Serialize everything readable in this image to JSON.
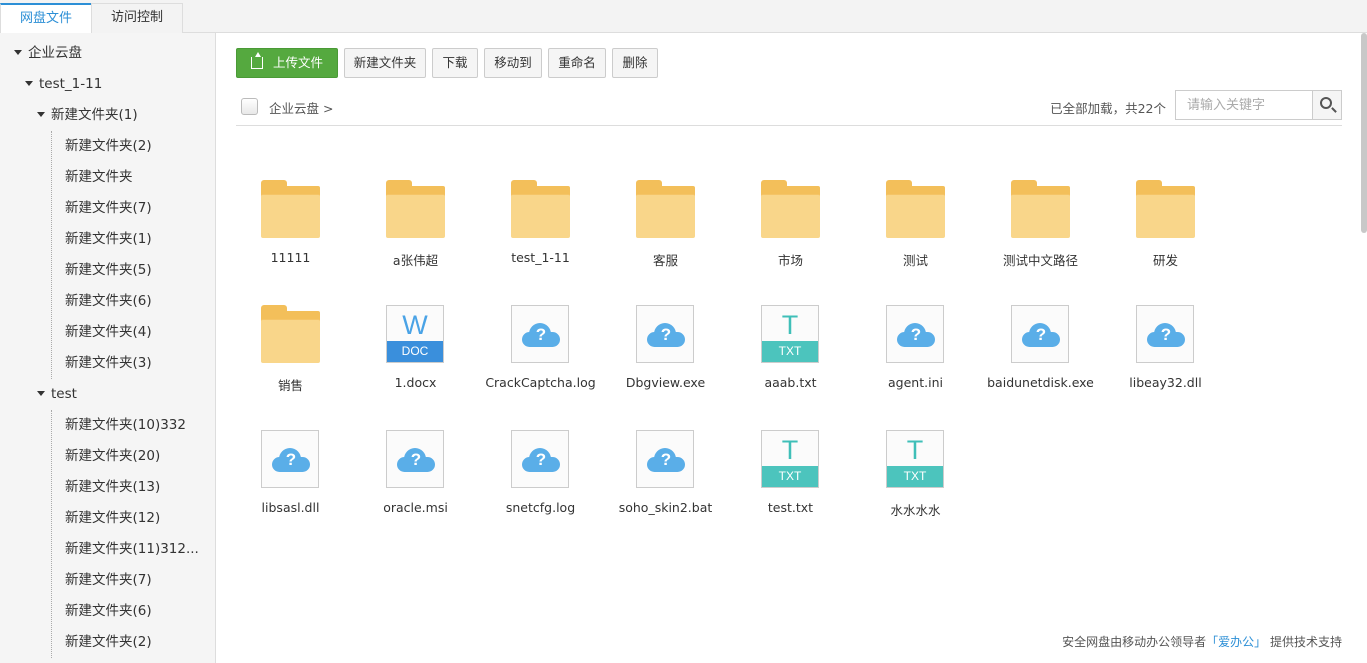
{
  "tabs": [
    {
      "label": "网盘文件",
      "active": true
    },
    {
      "label": "访问控制",
      "active": false
    }
  ],
  "sidebar": {
    "root": "企业云盘",
    "items": [
      {
        "label": "test_1-11",
        "level": 1,
        "expanded": true
      },
      {
        "label": "新建文件夹(1)",
        "level": 2,
        "expanded": true
      },
      {
        "label": "新建文件夹(2)",
        "level": 3
      },
      {
        "label": "新建文件夹",
        "level": 3
      },
      {
        "label": "新建文件夹(7)",
        "level": 3
      },
      {
        "label": "新建文件夹(1)",
        "level": 3
      },
      {
        "label": "新建文件夹(5)",
        "level": 3
      },
      {
        "label": "新建文件夹(6)",
        "level": 3
      },
      {
        "label": "新建文件夹(4)",
        "level": 3
      },
      {
        "label": "新建文件夹(3)",
        "level": 3
      },
      {
        "label": "test",
        "level": 2,
        "expanded": true
      },
      {
        "label": "新建文件夹(10)332",
        "level": 3
      },
      {
        "label": "新建文件夹(20)",
        "level": 3
      },
      {
        "label": "新建文件夹(13)",
        "level": 3
      },
      {
        "label": "新建文件夹(12)",
        "level": 3
      },
      {
        "label": "新建文件夹(11)312...",
        "level": 3
      },
      {
        "label": "新建文件夹(7)",
        "level": 3
      },
      {
        "label": "新建文件夹(6)",
        "level": 3
      },
      {
        "label": "新建文件夹(2)",
        "level": 3
      }
    ]
  },
  "toolbar": {
    "upload": "上传文件",
    "new_folder": "新建文件夹",
    "download": "下载",
    "move_to": "移动到",
    "rename": "重命名",
    "delete": "删除"
  },
  "pathbar": {
    "breadcrumb": "企业云盘 >",
    "status": "已全部加载，共22个",
    "search_placeholder": "请输入关键字"
  },
  "files": [
    {
      "name": "11111",
      "type": "folder"
    },
    {
      "name": "a张伟超",
      "type": "folder"
    },
    {
      "name": "test_1-11",
      "type": "folder"
    },
    {
      "name": "客服",
      "type": "folder"
    },
    {
      "name": "市场",
      "type": "folder"
    },
    {
      "name": "测试",
      "type": "folder"
    },
    {
      "name": "测试中文路径",
      "type": "folder"
    },
    {
      "name": "研发",
      "type": "folder"
    },
    {
      "name": "销售",
      "type": "folder"
    },
    {
      "name": "1.docx",
      "type": "word",
      "glyph": "W",
      "tag": "DOC"
    },
    {
      "name": "CrackCaptcha.log",
      "type": "unknown"
    },
    {
      "name": "Dbgview.exe",
      "type": "unknown"
    },
    {
      "name": "aaab.txt",
      "type": "txt",
      "glyph": "T",
      "tag": "TXT"
    },
    {
      "name": "agent.ini",
      "type": "unknown"
    },
    {
      "name": "baidunetdisk.exe",
      "type": "unknown"
    },
    {
      "name": "libeay32.dll",
      "type": "unknown"
    },
    {
      "name": "libsasl.dll",
      "type": "unknown"
    },
    {
      "name": "oracle.msi",
      "type": "unknown"
    },
    {
      "name": "snetcfg.log",
      "type": "unknown"
    },
    {
      "name": "soho_skin2.bat",
      "type": "unknown"
    },
    {
      "name": "test.txt",
      "type": "txt",
      "glyph": "T",
      "tag": "TXT"
    },
    {
      "name": "水水水水",
      "type": "txt",
      "glyph": "T",
      "tag": "TXT"
    }
  ],
  "footer": {
    "prefix": "安全网盘由移动办公领导者",
    "link": "「爱办公」",
    "suffix": " 提供技术支持"
  },
  "colors": {
    "accent": "#2c8fd6",
    "upload_button": "#55a93f",
    "folder": "#f9d68a",
    "cloud_icon": "#5aaee8",
    "txt_badge": "#4cc4bd",
    "doc_badge": "#3a8fdc"
  }
}
